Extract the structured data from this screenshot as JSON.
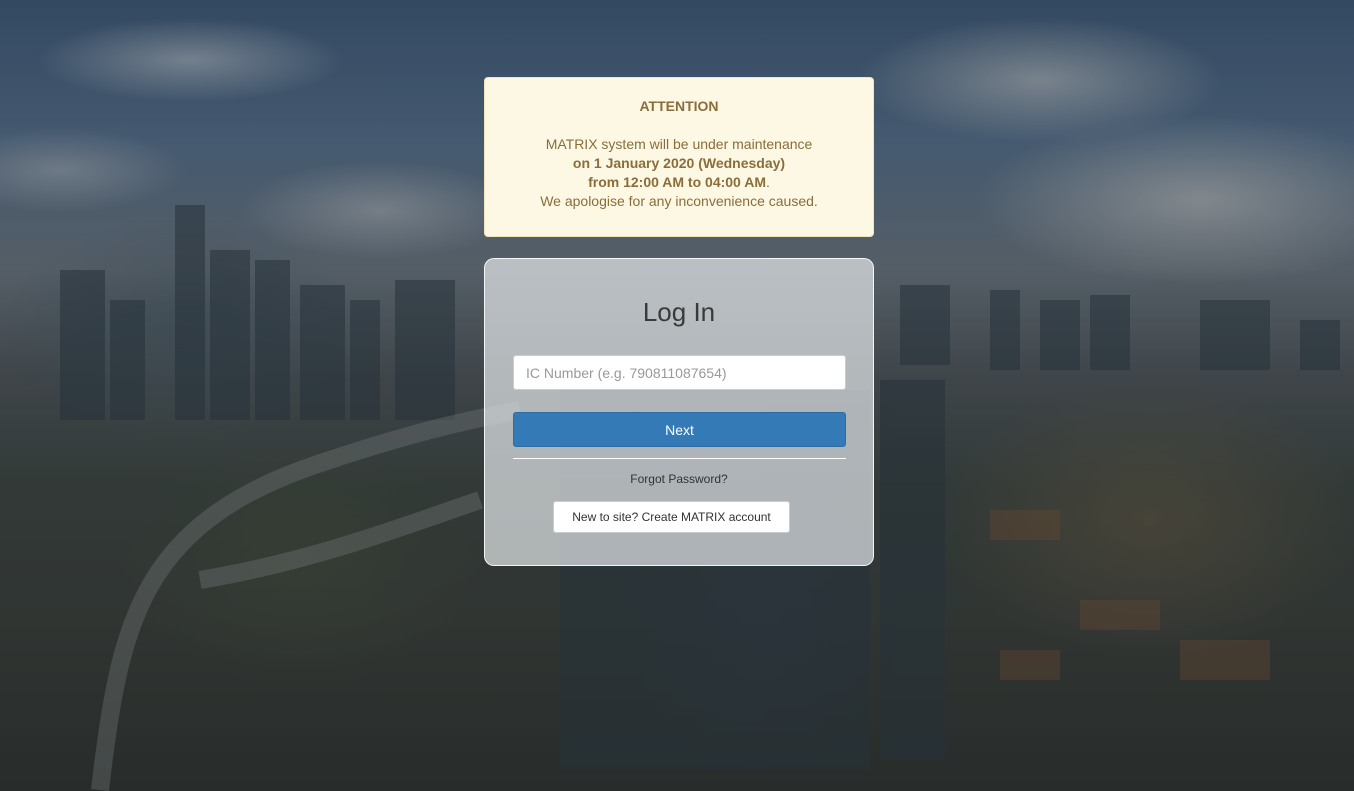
{
  "notice": {
    "title": "ATTENTION",
    "line1": "MATRIX system will be under maintenance",
    "line2": "on 1 January 2020 (Wednesday)",
    "line3_strong": "from 12:00 AM to 04:00 AM",
    "line3_suffix": ".",
    "line4": "We apologise for any inconvenience caused."
  },
  "login": {
    "heading": "Log In",
    "ic_placeholder": "IC Number (e.g. 790811087654)",
    "ic_value": "",
    "next_label": "Next",
    "forgot_label": "Forgot Password?",
    "create_label": "New to site? Create MATRIX account"
  },
  "colors": {
    "notice_bg": "#fcf8e3",
    "notice_text": "#8a6d3b",
    "primary_button": "#337ab7"
  }
}
